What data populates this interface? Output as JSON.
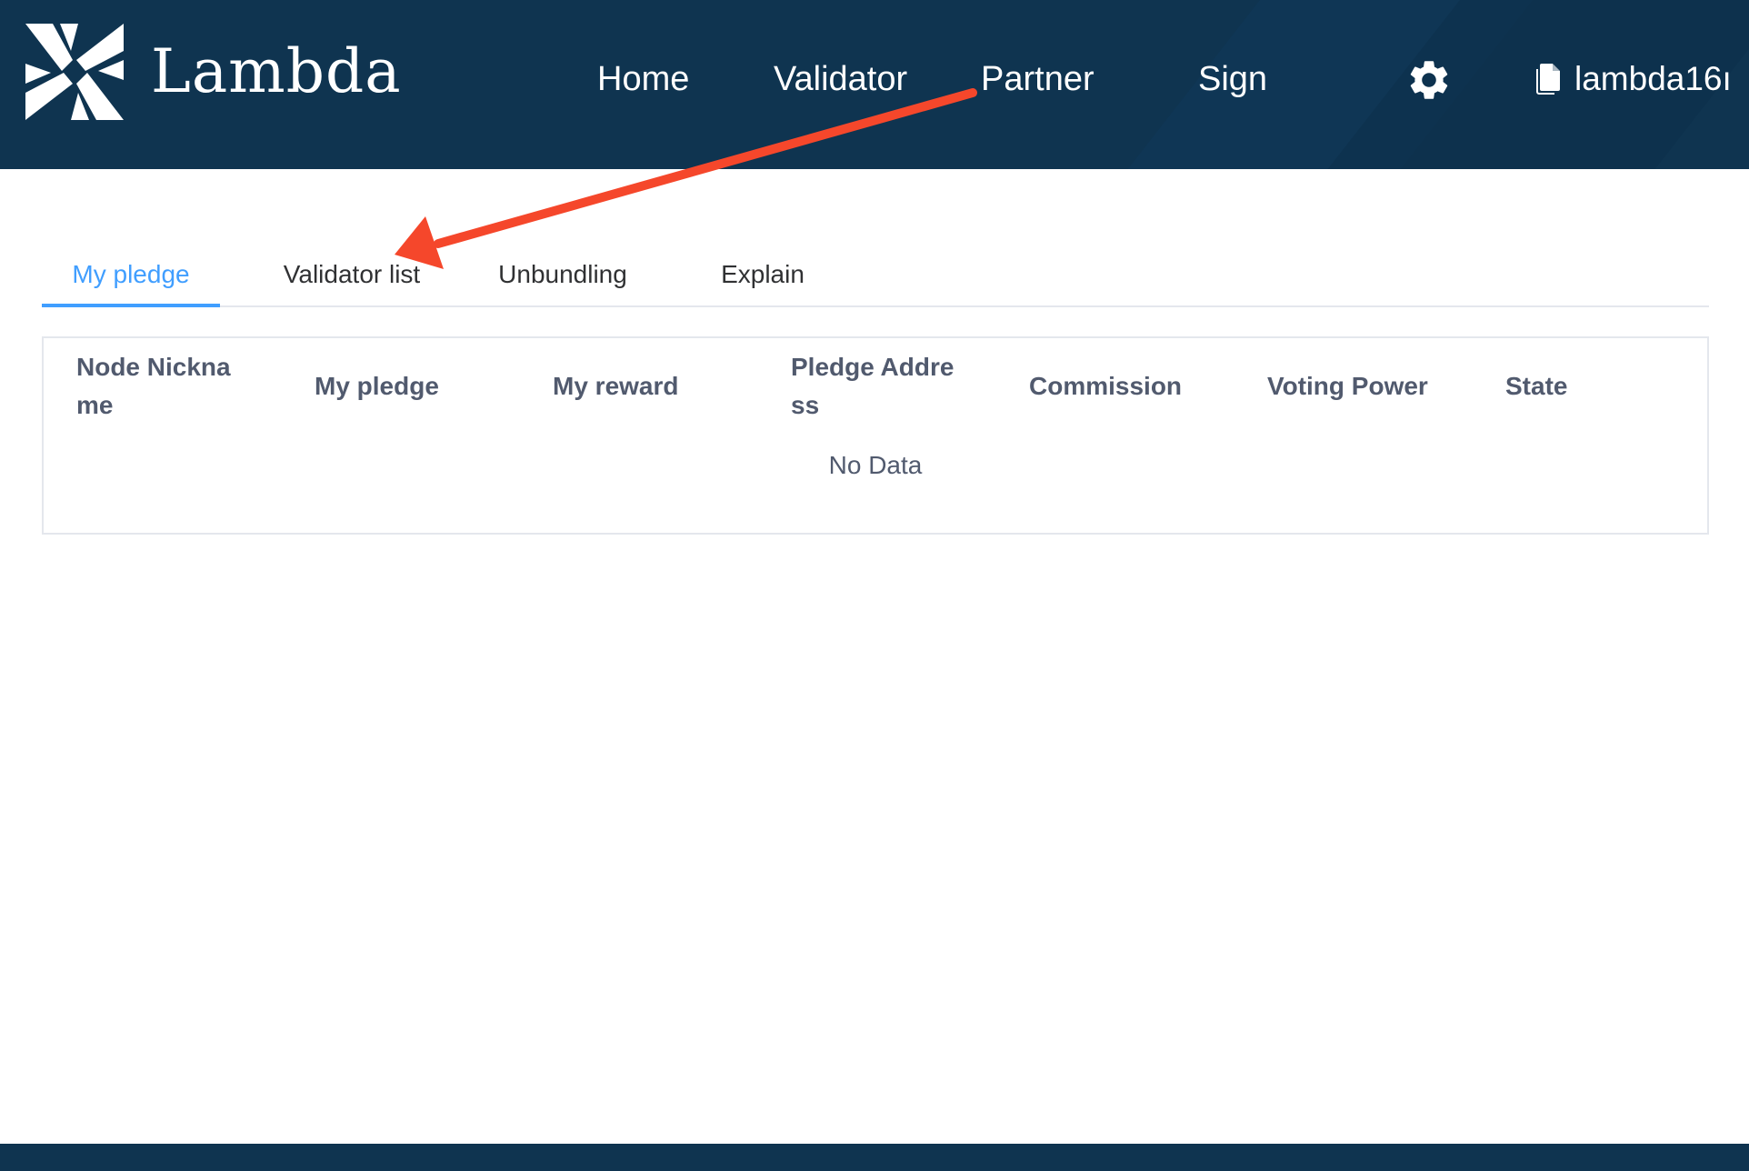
{
  "header": {
    "brand": "Lambda",
    "nav": [
      {
        "label": "Home"
      },
      {
        "label": "Validator"
      },
      {
        "label": "Partner"
      },
      {
        "label": "Sign"
      }
    ],
    "settings_icon": "gear-icon",
    "account": {
      "icon": "document-icon",
      "address": "lambda16ı"
    }
  },
  "tabs": [
    {
      "label": "My pledge",
      "active": true
    },
    {
      "label": "Validator list",
      "active": false
    },
    {
      "label": "Unbundling",
      "active": false
    },
    {
      "label": "Explain",
      "active": false
    }
  ],
  "table": {
    "columns": [
      {
        "line1": "Node Nickna",
        "line2": "me"
      },
      {
        "line1": "My pledge"
      },
      {
        "line1": "My reward"
      },
      {
        "line1": "Pledge Addre",
        "line2": "ss"
      },
      {
        "line1": "Commission"
      },
      {
        "line1": "Voting Power"
      },
      {
        "line1": "State"
      }
    ],
    "empty_text": "No Data"
  },
  "colors": {
    "header_bg": "#0f3450",
    "accent": "#409eff",
    "annotation_arrow": "#f5472b"
  }
}
